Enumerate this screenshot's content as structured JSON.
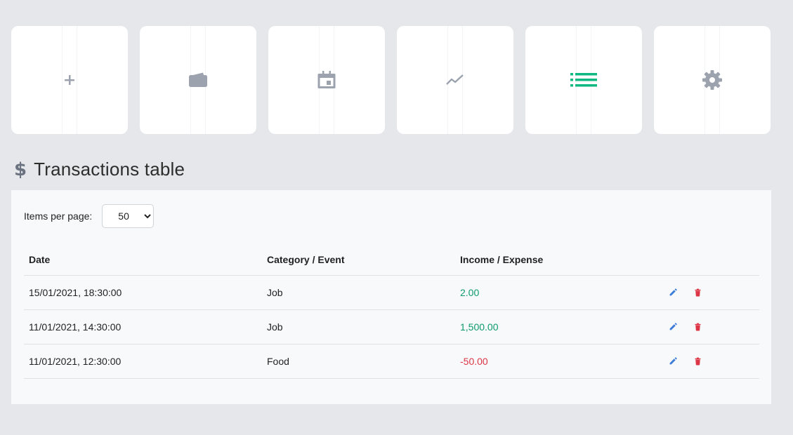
{
  "nav": {
    "cards": [
      {
        "name": "add",
        "icon": "plus-icon",
        "color": "#9ca3af"
      },
      {
        "name": "wallet",
        "icon": "wallet-icon",
        "color": "#9ca3af"
      },
      {
        "name": "calendar",
        "icon": "calendar-icon",
        "color": "#9ca3af"
      },
      {
        "name": "chart",
        "icon": "trend-chart-icon",
        "color": "#9ca3af"
      },
      {
        "name": "list",
        "icon": "list-icon",
        "color": "#10b981",
        "active": true
      },
      {
        "name": "settings",
        "icon": "gear-icon",
        "color": "#9ca3af"
      }
    ]
  },
  "section": {
    "icon_glyph": "$",
    "title": "Transactions table"
  },
  "controls": {
    "per_page_label": "Items per page:",
    "per_page_value": "50"
  },
  "table": {
    "headers": [
      "Date",
      "Category / Event",
      "Income / Expense"
    ],
    "rows": [
      {
        "date": "15/01/2021, 18:30:00",
        "category": "Job",
        "amount": "2.00",
        "type": "income"
      },
      {
        "date": "11/01/2021, 14:30:00",
        "category": "Job",
        "amount": "1,500.00",
        "type": "income"
      },
      {
        "date": "11/01/2021, 12:30:00",
        "category": "Food",
        "amount": "-50.00",
        "type": "expense"
      }
    ]
  },
  "colors": {
    "income": "#0d9a6c",
    "expense": "#dc3545",
    "edit": "#3b7dd8",
    "delete": "#dc3545",
    "active_nav": "#10b981"
  }
}
